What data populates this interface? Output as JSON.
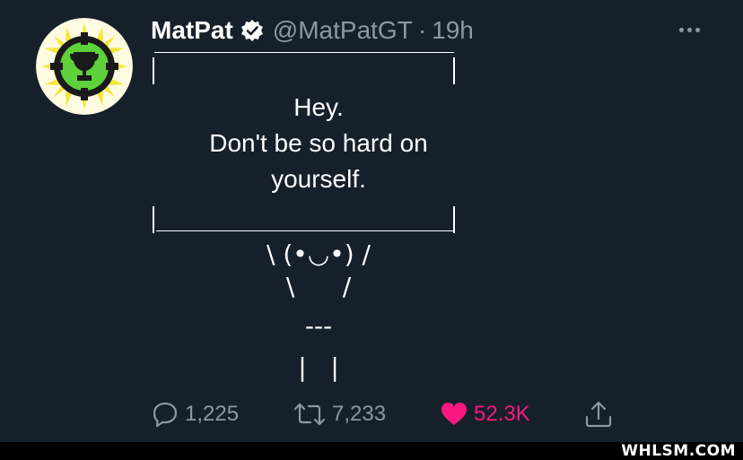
{
  "tweet": {
    "author_name": "MatPat",
    "handle": "@MatPatGT",
    "separator": "·",
    "time": "19h",
    "lines": [
      "Hey.",
      "Don't be so hard on",
      "yourself."
    ],
    "art": [
      "\\ (•◡•) /",
      "\\      /",
      "---",
      "|   |"
    ]
  },
  "actions": {
    "replies": "1,225",
    "retweets": "7,233",
    "likes": "52.3K"
  },
  "watermark": "WHLSM.COM",
  "colors": {
    "background": "#15202b",
    "secondary_text": "#8b98a5",
    "like": "#f91880",
    "logo_green": "#5fd13b",
    "logo_yellow": "#f5e63a"
  }
}
